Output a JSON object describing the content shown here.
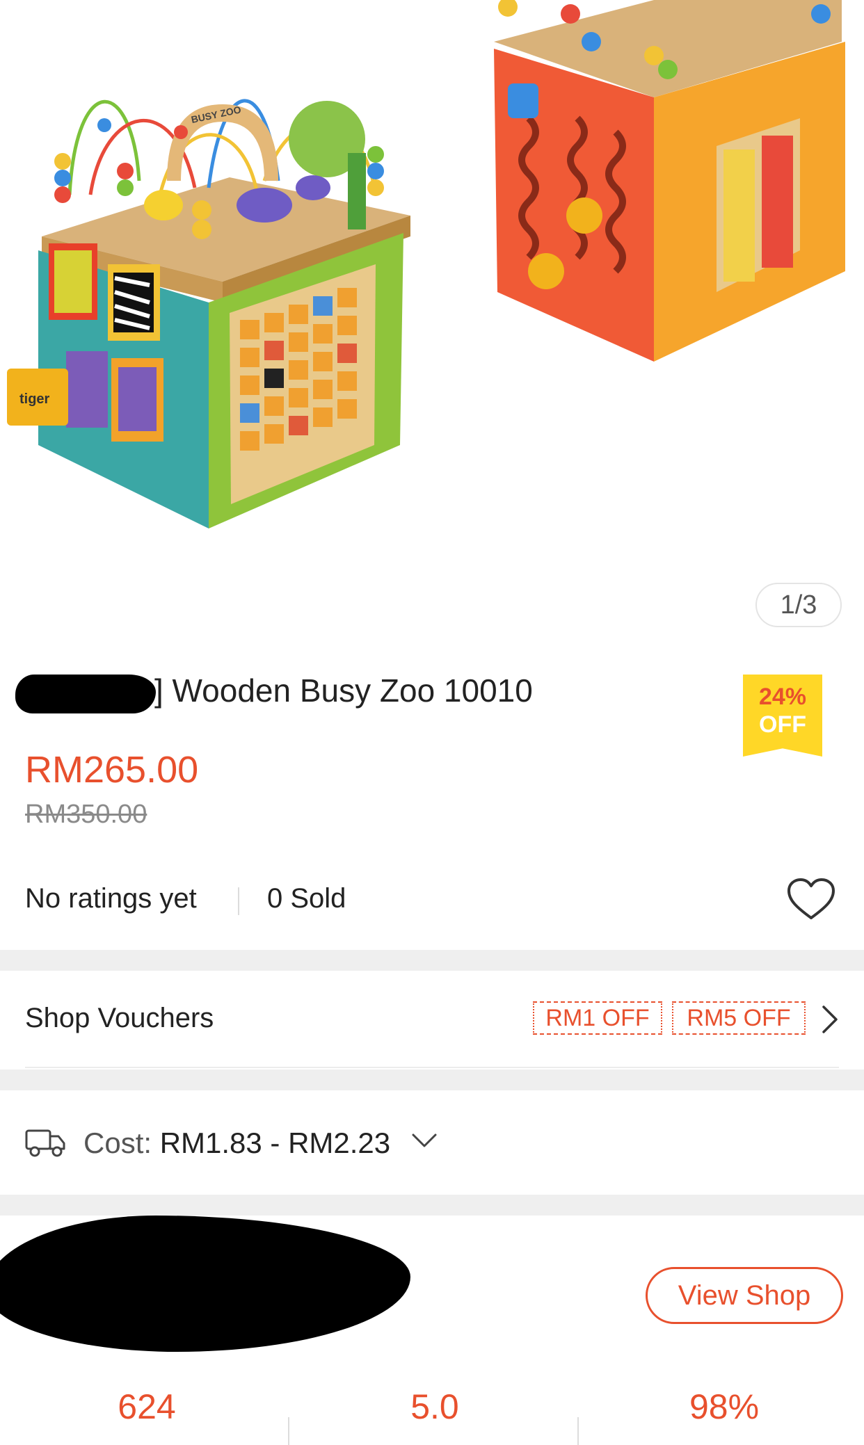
{
  "gallery": {
    "counter": "1/3",
    "main_toy_sign": "BUSY ZOO",
    "tag_text": "tiger"
  },
  "product": {
    "title": "] Wooden Busy Zoo 10010",
    "price": "RM265.00",
    "original_price": "RM350.00",
    "discount_percent": "24%",
    "discount_label": "OFF",
    "ratings": "No ratings yet",
    "sold": "0 Sold"
  },
  "vouchers": {
    "label": "Shop Vouchers",
    "items": [
      "RM1 OFF",
      "RM5 OFF"
    ]
  },
  "shipping": {
    "label": "Cost:",
    "value": "RM1.83 - RM2.23"
  },
  "shop": {
    "view_button": "View Shop",
    "stats": [
      "624",
      "5.0",
      "98%"
    ]
  },
  "colors": {
    "accent": "#e8502d",
    "badge": "#ffd727",
    "separator": "#efefef"
  },
  "icons": [
    "heart-icon",
    "chevron-right-icon",
    "truck-icon",
    "chevron-down-icon"
  ]
}
